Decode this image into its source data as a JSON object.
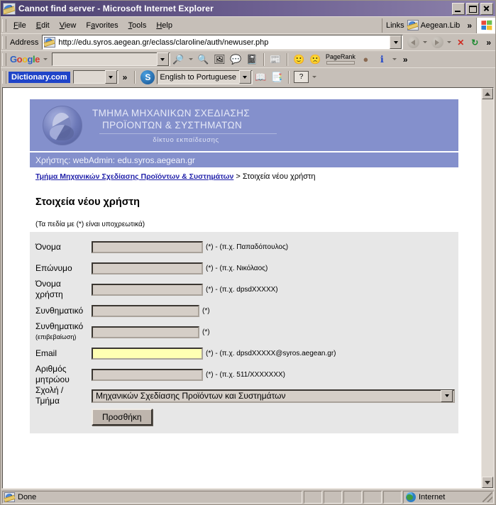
{
  "window": {
    "title": "Cannot find server - Microsoft Internet Explorer",
    "app_icon": "ie-document-icon",
    "minimize_label": "Minimize",
    "maximize_label": "Maximize",
    "close_label": "Close"
  },
  "menu": {
    "items": [
      {
        "label": "File",
        "accel": "F"
      },
      {
        "label": "Edit",
        "accel": "E"
      },
      {
        "label": "View",
        "accel": "V"
      },
      {
        "label": "Favorites",
        "accel": "a"
      },
      {
        "label": "Tools",
        "accel": "T"
      },
      {
        "label": "Help",
        "accel": "H"
      }
    ],
    "links_label": "Links",
    "links_item": "Aegean.Lib",
    "overflow": "»"
  },
  "address_bar": {
    "label": "Address",
    "url": "http://edu.syros.aegean.gr/eclass/claroline/auth/newuser.php",
    "placeholder": "Address",
    "back_label": "Back",
    "forward_label": "Forward",
    "stop_label": "Stop",
    "refresh_label": "Refresh",
    "stop_glyph": "✕",
    "refresh_glyph": "↻",
    "overflow": "»"
  },
  "google_toolbar": {
    "logo": "Google",
    "logo_letters": [
      "G",
      "o",
      "o",
      "g",
      "l",
      "e"
    ],
    "search_value": "",
    "search_placeholder": "",
    "pagerank_label": "PageRank",
    "icons": [
      {
        "name": "search-site-icon",
        "glyph": "🔍"
      },
      {
        "name": "highlight-icon",
        "glyph": "🖼"
      },
      {
        "name": "popup-blocker-icon",
        "glyph": "💬"
      },
      {
        "name": "autofill-icon",
        "glyph": "✎"
      },
      {
        "name": "news-icon",
        "glyph": "📰"
      },
      {
        "name": "vote-up-icon",
        "glyph": "🙂"
      },
      {
        "name": "vote-down-icon",
        "glyph": "🙁"
      },
      {
        "name": "info-icon",
        "glyph": "ℹ"
      }
    ],
    "overflow": "»"
  },
  "dictionary_toolbar": {
    "logo": "Dictionary.com",
    "search_value": "",
    "overflow": "»",
    "translate_value": "English to Portuguese",
    "icons": [
      {
        "name": "dictionary-book-icon",
        "glyph": "📖"
      },
      {
        "name": "thesaurus-icon",
        "glyph": "📑"
      },
      {
        "name": "help-icon",
        "glyph": "?"
      }
    ]
  },
  "page": {
    "banner": {
      "line1": "ΤΜΗΜΑ ΜΗΧΑΝΙΚΩΝ ΣΧΕΔΙΑΣΗΣ",
      "line2": "ΠΡΟΪΟΝΤΩΝ & ΣΥΣΤΗΜΑΤΩΝ",
      "subtitle": "δίκτυο εκπαίδευσης",
      "logo_name": "university-seal-logo",
      "bg_color": "#8490cc"
    },
    "userbar": "Χρήστης: webAdmin: edu.syros.aegean.gr",
    "breadcrumb": {
      "link": "Τμήμα Μηχανικών Σχεδίασης Προϊόντων & Συστημάτων",
      "separator": ">",
      "current": "Στοιχεία νέου χρήστη"
    },
    "title": "Στοιχεία νέου χρήστη",
    "required_note": "(Τα πεδία με (*) είναι υποχρεωτικά)",
    "form": {
      "fields": [
        {
          "label": "Όνομα",
          "sublabel": "",
          "value": "",
          "hint": "(*) - (π.χ. Παπαδόπουλος)",
          "type": "text",
          "width": "w1",
          "name": "firstname-input"
        },
        {
          "label": "Επώνυμο",
          "sublabel": "",
          "value": "",
          "hint": "(*) - (π.χ. Νικόλαος)",
          "type": "text",
          "width": "w1",
          "name": "lastname-input"
        },
        {
          "label": "Όνομα",
          "sublabel": "χρήστη",
          "value": "",
          "hint": "(*) - (π.χ. dpsdXXXXX)",
          "type": "text",
          "width": "w1",
          "name": "username-input"
        },
        {
          "label": "Συνθηματικό",
          "sublabel": "",
          "value": "",
          "hint": "(*)",
          "type": "password",
          "width": "w2",
          "name": "password-input"
        },
        {
          "label": "Συνθηματικό",
          "sublabel": "(επιβεβαίωση)",
          "value": "",
          "hint": "(*)",
          "type": "password",
          "width": "w2",
          "name": "password-confirm-input"
        },
        {
          "label": "Email",
          "sublabel": "",
          "value": "",
          "hint": "(*) - (π.χ. dpsdXXXXX@syros.aegean.gr)",
          "type": "email",
          "width": "email",
          "name": "email-input"
        },
        {
          "label": "Αριθμός",
          "sublabel": "μητρώου",
          "value": "",
          "hint": "(*) - (π.χ. 511/XXXXXXX)",
          "type": "text",
          "width": "w1",
          "name": "student-id-input"
        }
      ],
      "department": {
        "label": "Σχολή /",
        "sublabel": "Τμήμα",
        "value": "Μηχανικών Σχεδίασης Προϊόντων και Συστημάτων"
      },
      "submit_label": "Προσθήκη"
    }
  },
  "status_bar": {
    "message": "Done",
    "zone": "Internet",
    "zone_icon": "internet-globe-icon"
  },
  "colors": {
    "title_bar": "#6e6192",
    "banner": "#8490cc",
    "chrome": "#c6bfb8",
    "form_bg": "#e7e7e7",
    "email_highlight": "#ffffb3",
    "link": "#2222aa"
  }
}
